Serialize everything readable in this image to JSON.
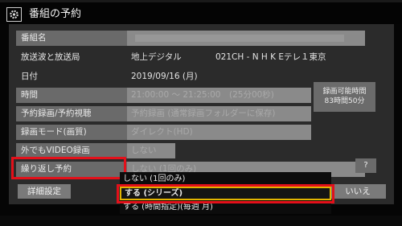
{
  "title_bar": {
    "icon": "gear-icon",
    "title": "番組の予約"
  },
  "rows": {
    "program_name": {
      "label": "番組名",
      "value": ""
    },
    "station": {
      "label": "放送波と放送局",
      "value_a": "地上デジタル",
      "value_b": "021CH - N H K Eテレ１東京"
    },
    "date": {
      "label": "日付",
      "value": "2019/09/16 (月)"
    },
    "time": {
      "label": "時間",
      "value": "21:00:00 ～ 21:25:00　(25分00秒)"
    },
    "reserve_type": {
      "label": "予約録画/予約視聴",
      "value": "予約録画 (通常録画フォルダーに保存)"
    },
    "record_mode": {
      "label": "録画モード(画質)",
      "value": "ダイレクト(HD)"
    },
    "video_outside": {
      "label": "外でもVIDEO録画",
      "value": "しない"
    },
    "repeat": {
      "label": "繰り返し予約",
      "value": "しない (1回のみ)"
    }
  },
  "side_info": {
    "line1": "録画可能時間",
    "line2": "83時間50分"
  },
  "help_label": "?",
  "detail_button": "詳細設定",
  "no_button": "いいえ",
  "dropdown": {
    "options": [
      "しない (1回のみ)",
      "する (シリーズ)",
      "する (時間指定)(毎週 月)"
    ],
    "selected_index": 1
  },
  "colors": {
    "highlight_red": "#e3101a",
    "selection_yellow": "#e2b400"
  }
}
